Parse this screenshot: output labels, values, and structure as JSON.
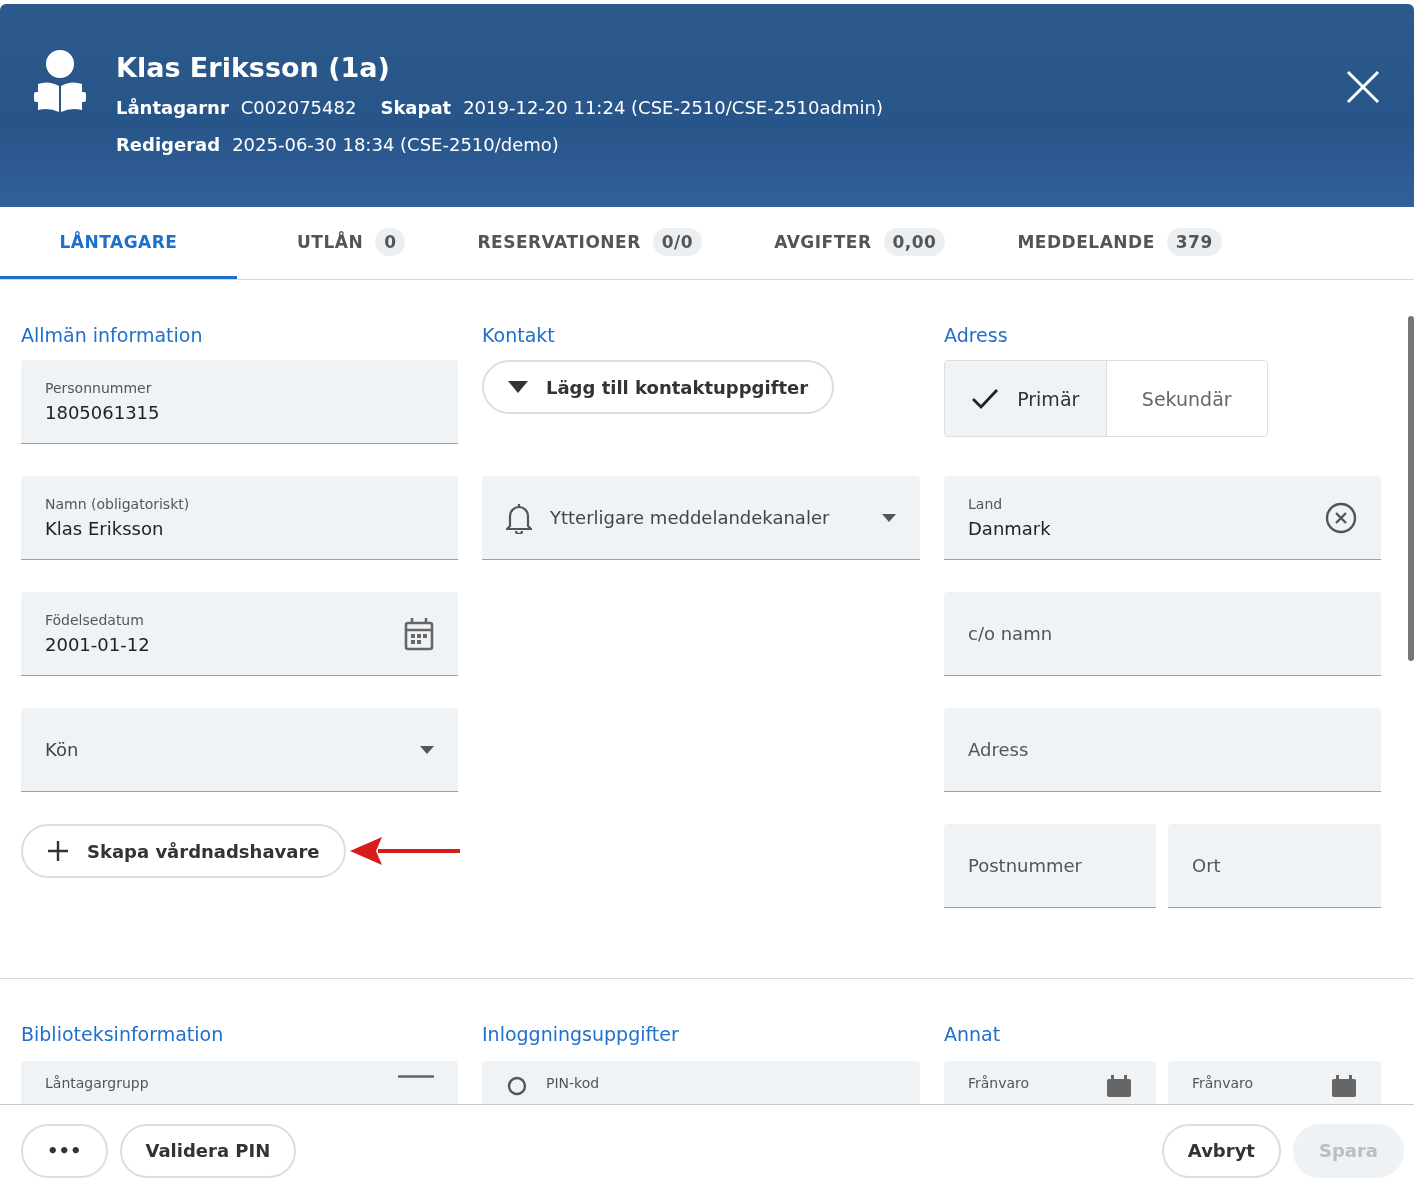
{
  "header": {
    "title": "Klas Eriksson (1a)",
    "facts": [
      {
        "label": "Låntagarnr",
        "value": "C002075482"
      },
      {
        "label": "Skapat",
        "value": "2019-12-20 11:24 (CSE-2510/CSE-2510admin)"
      },
      {
        "label": "Redigerad",
        "value": "2025-06-30 18:34 (CSE-2510/demo)"
      }
    ]
  },
  "tabs": [
    {
      "label": "LÅNTAGARE",
      "selected": true
    },
    {
      "label": "UTLÅN",
      "count": "0",
      "selected": false
    },
    {
      "label": "RESERVATIONER",
      "count": "0/0",
      "selected": false
    },
    {
      "label": "AVGIFTER",
      "count": "0,00",
      "selected": false
    },
    {
      "label": "MEDDELANDE",
      "count": "379",
      "selected": false
    }
  ],
  "general": {
    "title": "Allmän information",
    "fields": [
      {
        "kind": "text",
        "label": "Personnummer",
        "value": "1805061315"
      },
      {
        "kind": "text",
        "label": "Namn (obligatoriskt)",
        "value": "Klas Eriksson"
      },
      {
        "kind": "date",
        "label": "Födelsedatum",
        "value": "2001-01-12"
      },
      {
        "kind": "select",
        "placeholder": "Kön"
      }
    ],
    "add_guardian": "Skapa vårdnadshavare"
  },
  "contact": {
    "title": "Kontakt",
    "expand_button": "Lägg till kontaktuppgifter",
    "channels": {
      "placeholder": "Ytterligare meddelandekanaler"
    }
  },
  "address": {
    "title": "Adress",
    "toggle": [
      {
        "label": "Primär",
        "selected": true
      },
      {
        "label": "Sekundär",
        "selected": false
      }
    ],
    "country": {
      "label": "Land",
      "value": "Danmark"
    },
    "fields": [
      {
        "placeholder": "c/o namn"
      },
      {
        "placeholder": "Adress"
      }
    ],
    "postal": [
      {
        "placeholder": "Postnummer"
      },
      {
        "placeholder": "Ort"
      }
    ]
  },
  "library": {
    "title": "Biblioteksinformation",
    "field": {
      "label": "Låntagargrupp"
    }
  },
  "login": {
    "title": "Inloggningsuppgifter",
    "field": {
      "label": "PIN-kod"
    }
  },
  "other": {
    "title": "Annat",
    "fields": [
      {
        "label": "Frånvaro"
      },
      {
        "label": "Frånvaro"
      }
    ]
  },
  "footer": {
    "left": [
      {
        "label": "•••",
        "disabled": false
      },
      {
        "label": "Validera PIN",
        "disabled": false
      }
    ],
    "right": [
      {
        "label": "Avbryt",
        "disabled": false
      },
      {
        "label": "Spara",
        "disabled": true
      }
    ]
  }
}
